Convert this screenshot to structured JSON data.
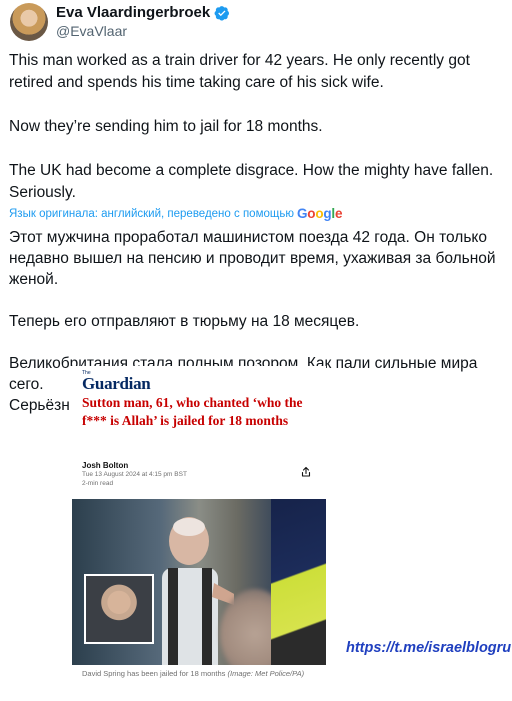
{
  "header": {
    "display_name": "Eva Vlaardingerbroek",
    "handle": "@EvaVlaar"
  },
  "tweet": {
    "lines_p1": [
      "This man worked as a train driver for 42 years. He only recently got",
      "retired and spends his time taking care of his sick wife."
    ],
    "p2": "Now they’re sending him to jail for 18 months.",
    "lines_p3": [
      "The UK had become a complete disgrace. How the mighty have fallen.",
      "Seriously."
    ]
  },
  "translation": {
    "translated_by": "Язык оригинала: английский, переведено с помощью",
    "google_letters": [
      "G",
      "o",
      "o",
      "g",
      "l",
      "e"
    ],
    "google_colors": [
      "#4285F4",
      "#EA4335",
      "#FBBC05",
      "#4285F4",
      "#34A853",
      "#EA4335"
    ],
    "lines_p1": [
      "Этот мужчина проработал машинистом поезда 42 года. Он только",
      "недавно вышел на пенсию и проводит время, ухаживая за больной",
      "женой."
    ],
    "p2": "Теперь его отправляют в тюрьму на 18 месяцев.",
    "lines_p3": [
      "Великобритания стала полным позором. Как пали сильные мира сего.",
      "Серьёзно."
    ]
  },
  "article": {
    "masthead": "Guardian",
    "masthead_small": "The",
    "headline": "Sutton man, 61, who chanted ‘who the f*** is Allah’ is jailed for 18 months",
    "author": "Josh Bolton",
    "date": "Tue 13 August 2024 at 4:15 pm BST",
    "read_time": "2-min read",
    "caption": "David Spring has been jailed for 18 months",
    "caption_credit": "(Image: Met Police/PA)"
  },
  "watermark": "https://t.me/israelblogru",
  "colors": {
    "verified": "#1d9bf0",
    "link_blue": "#1d9bf0",
    "guardian_navy": "#052962",
    "headline_red": "#c70000"
  }
}
